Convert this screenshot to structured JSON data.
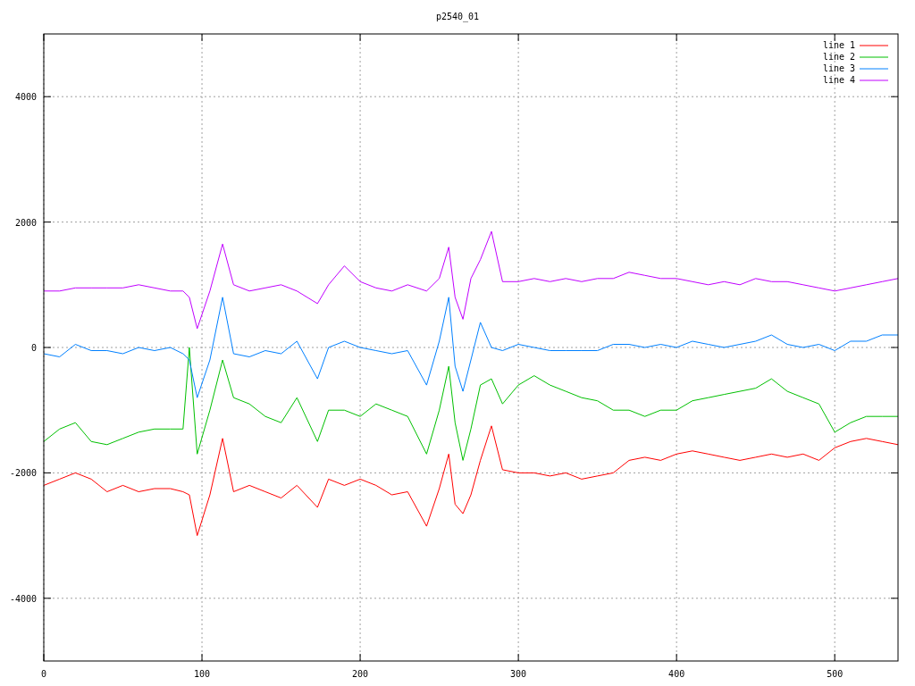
{
  "plot": {
    "chart_data": {
      "type": "line",
      "title": "p2540_01",
      "x": [
        0,
        10,
        20,
        30,
        40,
        50,
        60,
        70,
        80,
        88,
        92,
        97,
        105,
        113,
        120,
        130,
        140,
        150,
        160,
        173,
        180,
        190,
        200,
        210,
        220,
        230,
        242,
        250,
        256,
        260,
        265,
        270,
        276,
        283,
        290,
        300,
        310,
        320,
        330,
        340,
        350,
        360,
        370,
        380,
        390,
        400,
        410,
        420,
        430,
        440,
        450,
        460,
        470,
        480,
        490,
        500,
        510,
        520,
        530,
        540
      ],
      "grid": true,
      "legend": true,
      "xlim": [
        0,
        540
      ],
      "ylim": [
        -5000,
        5000
      ],
      "xticks": [
        0,
        100,
        200,
        300,
        400,
        500
      ],
      "yticks": [
        -4000,
        -2000,
        0,
        2000,
        4000
      ],
      "series": [
        {
          "name": "line 1",
          "color": "#ff0000",
          "values": [
            -2200,
            -2100,
            -2000,
            -2100,
            -2300,
            -2200,
            -2300,
            -2250,
            -2250,
            -2300,
            -2350,
            -3000,
            -2350,
            -1450,
            -2300,
            -2200,
            -2300,
            -2400,
            -2200,
            -2550,
            -2100,
            -2200,
            -2100,
            -2200,
            -2350,
            -2300,
            -2850,
            -2250,
            -1700,
            -2500,
            -2650,
            -2350,
            -1800,
            -1250,
            -1950,
            -2000,
            -2000,
            -2050,
            -2000,
            -2100,
            -2050,
            -2000,
            -1800,
            -1750,
            -1800,
            -1700,
            -1650,
            -1700,
            -1750,
            -1800,
            -1750,
            -1700,
            -1750,
            -1700,
            -1800,
            -1600,
            -1500,
            -1450,
            -1500,
            -1550
          ]
        },
        {
          "name": "line 2",
          "color": "#00c000",
          "values": [
            -1500,
            -1300,
            -1200,
            -1500,
            -1550,
            -1450,
            -1350,
            -1300,
            -1300,
            -1300,
            0,
            -1700,
            -1000,
            -200,
            -800,
            -900,
            -1100,
            -1200,
            -800,
            -1500,
            -1000,
            -1000,
            -1100,
            -900,
            -1000,
            -1100,
            -1700,
            -1000,
            -300,
            -1200,
            -1800,
            -1300,
            -600,
            -500,
            -900,
            -600,
            -450,
            -600,
            -700,
            -800,
            -850,
            -1000,
            -1000,
            -1100,
            -1000,
            -1000,
            -850,
            -800,
            -750,
            -700,
            -650,
            -500,
            -700,
            -800,
            -900,
            -1350,
            -1200,
            -1100,
            -1100,
            -1100
          ]
        },
        {
          "name": "line 3",
          "color": "#0080ff",
          "values": [
            -100,
            -150,
            50,
            -50,
            -50,
            -100,
            0,
            -50,
            0,
            -100,
            -200,
            -800,
            -200,
            800,
            -100,
            -150,
            -50,
            -100,
            100,
            -500,
            0,
            100,
            0,
            -50,
            -100,
            -50,
            -600,
            100,
            800,
            -300,
            -700,
            -200,
            400,
            0,
            -50,
            50,
            0,
            -50,
            -50,
            -50,
            -50,
            50,
            50,
            0,
            50,
            0,
            100,
            50,
            0,
            50,
            100,
            200,
            50,
            0,
            50,
            -50,
            100,
            100,
            200,
            200
          ]
        },
        {
          "name": "line 4",
          "color": "#c000ff",
          "values": [
            900,
            900,
            950,
            950,
            950,
            950,
            1000,
            950,
            900,
            900,
            800,
            300,
            900,
            1650,
            1000,
            900,
            950,
            1000,
            900,
            700,
            1000,
            1300,
            1050,
            950,
            900,
            1000,
            900,
            1100,
            1600,
            800,
            450,
            1100,
            1400,
            1850,
            1050,
            1050,
            1100,
            1050,
            1100,
            1050,
            1100,
            1100,
            1200,
            1150,
            1100,
            1100,
            1050,
            1000,
            1050,
            1000,
            1100,
            1050,
            1050,
            1000,
            950,
            900,
            950,
            1000,
            1050,
            1100
          ]
        }
      ]
    }
  }
}
